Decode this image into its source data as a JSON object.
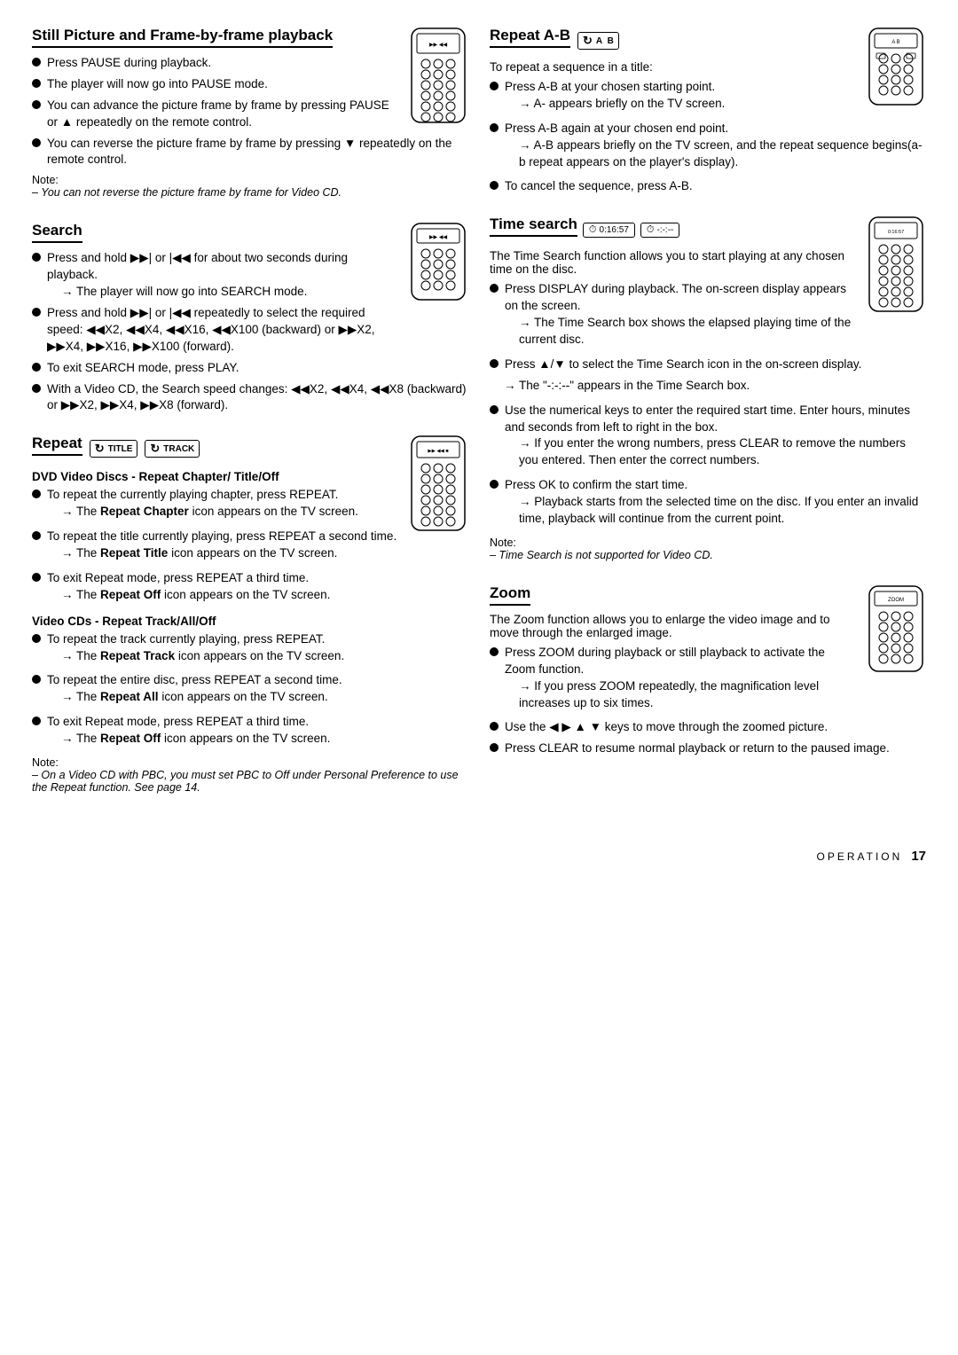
{
  "left_col": {
    "still_picture": {
      "title": "Still Picture and Frame-by-frame playback",
      "bullets": [
        "Press PAUSE during playback.",
        "The player will now go into PAUSE mode.",
        "You can advance the picture frame by frame by pressing PAUSE or ▲ repeatedly on the remote control.",
        "You can reverse the picture frame by frame by pressing ▼ repeatedly on the remote control."
      ],
      "note_label": "Note:",
      "note_text": "– You can not reverse the picture frame by frame for Video CD."
    },
    "search": {
      "title": "Search",
      "bullets": [
        {
          "text": "Press and hold ▶▶| or |◀◀ for about two seconds during playback.",
          "arrow": "→ The player will now go into SEARCH mode."
        },
        {
          "text": "Press and hold ▶▶| or |◀◀ repeatedly to select the required speed: ◀◀X2, ◀◀X4, ◀◀X16, ◀◀X100 (backward) or ▶▶X2, ▶▶X4, ▶▶X16, ▶▶X100 (forward).",
          "arrow": null
        },
        {
          "text": "To exit SEARCH mode, press PLAY.",
          "arrow": null
        },
        {
          "text": "With a Video CD, the Search speed changes: ◀◀X2, ◀◀X4, ◀◀X8 (backward) or ▶▶X2, ▶▶X4, ▶▶X8 (forward).",
          "arrow": null
        }
      ]
    },
    "repeat": {
      "title": "Repeat",
      "title_icons": [
        "TITLE",
        "TRACK"
      ],
      "dvd_subtitle": "DVD Video Discs - Repeat Chapter/ Title/Off",
      "dvd_bullets": [
        {
          "text": "To repeat the currently playing chapter, press REPEAT.",
          "arrow": "→ The Repeat Chapter icon appears on the TV screen."
        },
        {
          "text": "To repeat the title currently playing, press REPEAT a second time.",
          "arrow": "→ The Repeat Title icon appears on the TV screen."
        },
        {
          "text": "To exit Repeat mode, press REPEAT a third time.",
          "arrow": "→ The Repeat Off icon appears on the TV screen."
        }
      ],
      "vcd_subtitle": "Video CDs - Repeat Track/All/Off",
      "vcd_bullets": [
        {
          "text": "To repeat the track currently playing, press REPEAT.",
          "arrow": "→ The Repeat Track icon appears on the TV screen."
        },
        {
          "text": "To repeat the entire disc, press REPEAT a second time.",
          "arrow": "→ The Repeat All icon appears on the TV screen."
        },
        {
          "text": "To exit Repeat mode, press REPEAT a third time.",
          "arrow": "→ The Repeat Off icon appears on the TV screen."
        }
      ],
      "note_label": "Note:",
      "note_text": "– On a Video CD with PBC, you must set PBC to Off under Personal Preference to use the Repeat function. See page 14."
    }
  },
  "right_col": {
    "repeat_ab": {
      "title": "Repeat A-B",
      "intro": "To repeat a sequence in a title:",
      "bullets": [
        {
          "text": "Press A-B at your chosen starting point.",
          "arrow": "→ A- appears briefly on the TV screen."
        },
        {
          "text": "Press A-B again at your chosen end point.",
          "arrow": "→ A-B appears briefly on the TV screen, and the repeat sequence begins(a-b repeat appears on the player's display)."
        },
        {
          "text": "To cancel the sequence, press A-B.",
          "arrow": null
        }
      ]
    },
    "time_search": {
      "title": "Time search",
      "icon1": "0:16:57",
      "icon2": "-:-:--",
      "intro": "The Time Search function allows you to start playing at any chosen time on the disc.",
      "bullets": [
        {
          "text": "Press DISPLAY during playback. The on-screen display appears on the screen.",
          "arrow": "→ The Time Search box shows the elapsed playing time of the current disc."
        },
        {
          "text": "Press ▲/▼ to select the Time Search icon in the on-screen display.",
          "arrow": null
        },
        {
          "text": "The \"-:-:--\" appears in the Time Search box.",
          "arrow": null,
          "is_arrow": true
        },
        {
          "text": "Use the numerical keys to enter the required start time. Enter hours, minutes and seconds from left to right in the box.",
          "arrow": "→ If you enter the wrong numbers, press CLEAR to remove the numbers you entered. Then enter the correct numbers.",
          "has_use": true
        },
        {
          "text": "Press OK to confirm the start time.",
          "arrow": "→ Playback starts from the selected time on the disc. If you enter an invalid time, playback will continue from the current point."
        }
      ],
      "note_label": "Note:",
      "note_text": "– Time Search is not supported for Video CD."
    },
    "zoom": {
      "title": "Zoom",
      "intro": "The Zoom function allows you to enlarge the video image and to move through the enlarged image.",
      "bullets": [
        {
          "text": "Press ZOOM during playback or still playback to activate the Zoom function.",
          "arrow": "→ If you press ZOOM repeatedly, the magnification level increases up to six times."
        },
        {
          "text": "Use the ◀ ▶ ▲ ▼ keys to move through the zoomed picture.",
          "has_use": true
        },
        {
          "text": "Press CLEAR to resume normal playback or return to the paused image.",
          "arrow": null
        }
      ]
    }
  },
  "footer": {
    "label": "Operation",
    "page": "17"
  }
}
